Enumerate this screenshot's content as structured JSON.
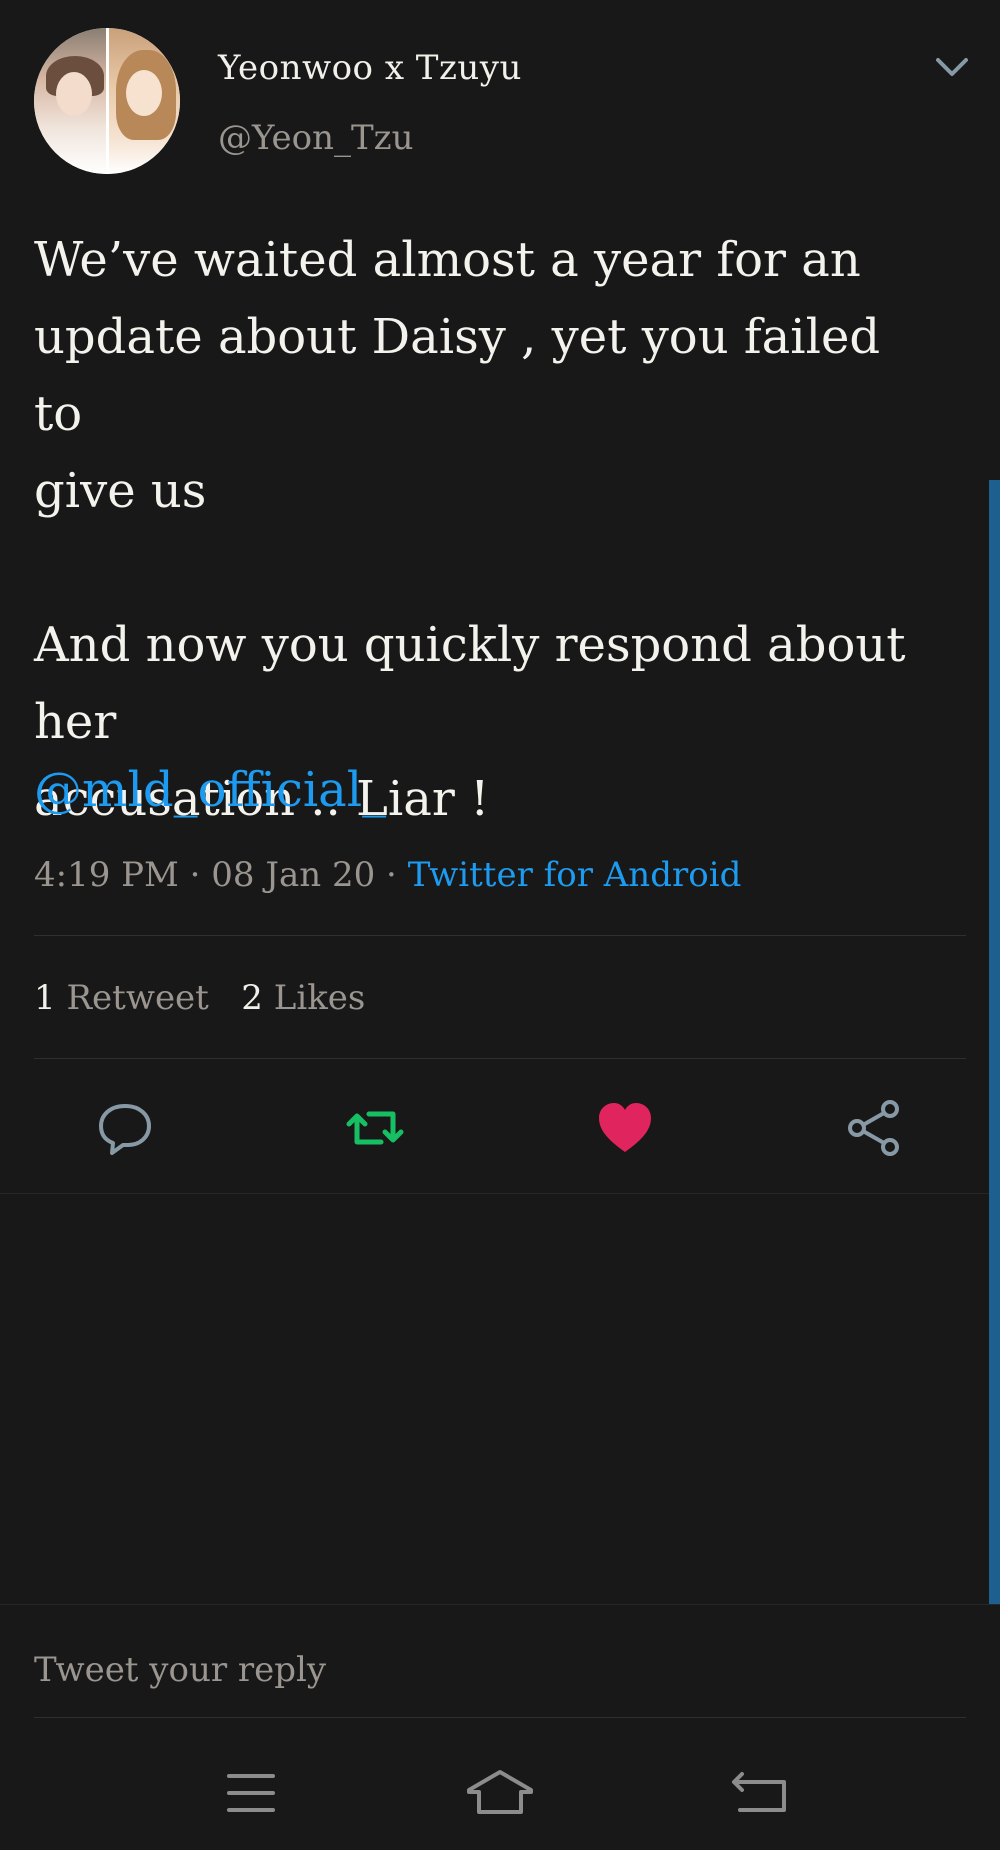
{
  "tweet": {
    "display_name": "Yeonwoo x Tzuyu",
    "handle": "@Yeon_Tzu",
    "text": "We’ve waited almost a year for an\nupdate about Daisy , yet you failed to\ngive us\n\nAnd now you quickly respond about her\naccusation .. Liar !",
    "mention": "@mld_official_",
    "time": "4:19 PM",
    "separator1": " · ",
    "date": "08 Jan 20",
    "separator2": " · ",
    "source": "Twitter for Android"
  },
  "stats": {
    "retweet_count": "1",
    "retweet_label": "Retweet",
    "like_count": "2",
    "like_label": "Likes"
  },
  "actions": {
    "reply_icon": "reply-icon",
    "retweet_icon": "retweet-icon",
    "like_icon": "heart-icon",
    "share_icon": "share-icon"
  },
  "reply_box": {
    "placeholder": "Tweet your reply"
  },
  "nav_bar": {
    "icons": [
      "menu-icon",
      "home-icon",
      "back-icon"
    ]
  },
  "colors": {
    "background": "#181818",
    "link": "#1d9bf0",
    "retweet": "#17bf63",
    "like": "#e0245e",
    "muted": "#9b9590",
    "icon": "#8899a6"
  }
}
